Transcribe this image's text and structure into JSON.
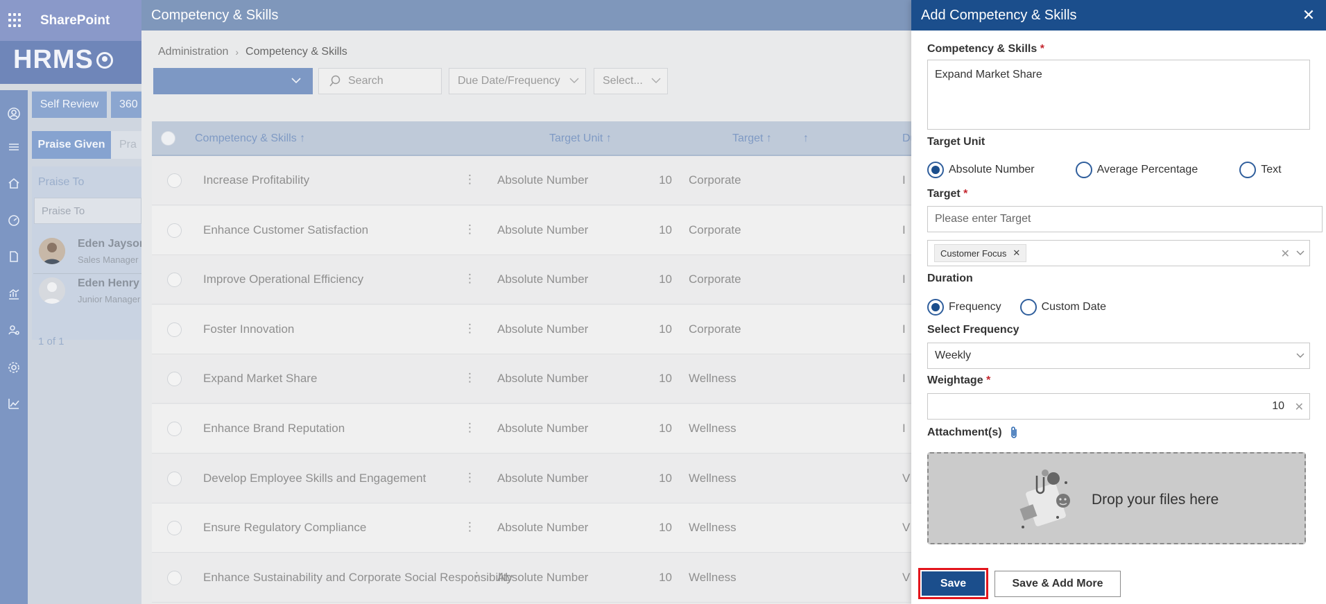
{
  "app": {
    "suite_name": "SharePoint",
    "logo_text": "HRMS"
  },
  "background": {
    "tabs": [
      "Self Review",
      "360"
    ],
    "subtabs": [
      "Praise Given",
      "Pra"
    ],
    "praise_to_label": "Praise To",
    "praise_to_placeholder": "Praise To",
    "people": [
      {
        "name": "Eden Jayson",
        "role": "Sales Manager"
      },
      {
        "name": "Eden Henry",
        "role": "Junior Manager"
      }
    ],
    "pagination": "1 of 1"
  },
  "main": {
    "title": "Competency & Skills",
    "breadcrumb": {
      "parent": "Administration",
      "current": "Competency & Skills"
    },
    "search_placeholder": "Search",
    "due_date_placeholder": "Due Date/Frequency",
    "select_placeholder": "Select...",
    "columns": {
      "name": "Competency & Skills",
      "unit": "Target Unit",
      "target": "Target",
      "sort_arrow": "↑",
      "partial": "Du"
    },
    "rows": [
      {
        "name": "Increase Profitability",
        "unit": "Absolute Number",
        "target": "10",
        "category": "Corporate",
        "edge": "I"
      },
      {
        "name": "Enhance Customer Satisfaction",
        "unit": "Absolute Number",
        "target": "10",
        "category": "Corporate",
        "edge": "I"
      },
      {
        "name": "Improve Operational Efficiency",
        "unit": "Absolute Number",
        "target": "10",
        "category": "Corporate",
        "edge": "I"
      },
      {
        "name": "Foster Innovation",
        "unit": "Absolute Number",
        "target": "10",
        "category": "Corporate",
        "edge": "I"
      },
      {
        "name": "Expand Market Share",
        "unit": "Absolute Number",
        "target": "10",
        "category": "Wellness",
        "edge": "I"
      },
      {
        "name": "Enhance Brand Reputation",
        "unit": "Absolute Number",
        "target": "10",
        "category": "Wellness",
        "edge": "I"
      },
      {
        "name": "Develop Employee Skills and Engagement",
        "unit": "Absolute Number",
        "target": "10",
        "category": "Wellness",
        "edge": "V"
      },
      {
        "name": "Ensure Regulatory Compliance",
        "unit": "Absolute Number",
        "target": "10",
        "category": "Wellness",
        "edge": "V"
      },
      {
        "name": "Enhance Sustainability and Corporate Social Responsibility",
        "unit": "Absolute Number",
        "target": "10",
        "category": "Wellness",
        "edge": "V"
      }
    ]
  },
  "panel": {
    "title": "Add Competency & Skills",
    "competency_label": "Competency & Skills",
    "competency_value": "Expand Market Share",
    "target_unit_label": "Target Unit",
    "target_unit_options": [
      "Absolute Number",
      "Average Percentage",
      "Text"
    ],
    "target_unit_selected": "Absolute Number",
    "target_label": "Target",
    "target_placeholder": "Please enter Target",
    "tag": "Customer Focus",
    "duration_label": "Duration",
    "duration_options": [
      "Frequency",
      "Custom Date"
    ],
    "duration_selected": "Frequency",
    "frequency_label": "Select Frequency",
    "frequency_value": "Weekly",
    "weightage_label": "Weightage",
    "weightage_value": "10",
    "attachments_label": "Attachment(s)",
    "drop_text": "Drop your files here",
    "save_label": "Save",
    "save_more_label": "Save & Add More",
    "required_mark": "*"
  },
  "colors": {
    "panel_header": "#1b4e8c",
    "primary_button": "#1b4e8c",
    "highlight_border": "#e3151c"
  }
}
